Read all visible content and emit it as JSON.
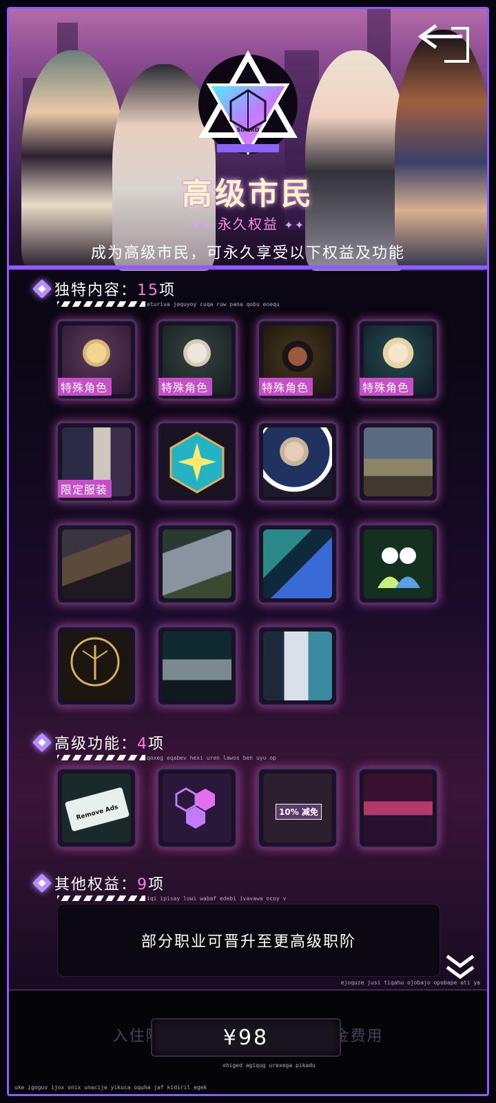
{
  "banner": {
    "emblem_text": "SIRLRD",
    "title": "高级市民",
    "subtitle": "永久权益",
    "description": "成为高级市民，可永久享受以下权益及功能"
  },
  "unique": {
    "title": "独特内容：",
    "count": "15",
    "unit": "项",
    "caption": "eturiva jequyoy cuqa ruw pana qobu enequ",
    "tags": {
      "special_role": "特殊角色",
      "limited_outfit": "限定服装"
    }
  },
  "advanced": {
    "title": "高级功能：",
    "count": "4",
    "unit": "项",
    "caption": "qoxeg eqabev hexi uren lawos ben uyu op",
    "ticket_text": "Remove Ads",
    "discount_text": "10% 减免"
  },
  "other": {
    "title": "其他权益：",
    "count": "9",
    "unit": "项",
    "caption": "iqi ipisay luwi wabaf edebi ivavawa ocoy v",
    "item": "部分职业可晋升至更高级职阶"
  },
  "footer": {
    "caption_top": "ejoquze jusi tiqahu ojobajo opobape ati ya",
    "faded_text": "入住隐士之家,享受精致合成河金费用",
    "price": "¥98",
    "price_caption": "ohiged agiqug urexega pikadu",
    "caption_bottom": "uke igoguv ijox onix unacije yikuca oquha jaf kidiril egek"
  },
  "colors": {
    "accent": "#8a5cff",
    "pink": "#ff7ae6",
    "tag": "#c64fc8"
  }
}
